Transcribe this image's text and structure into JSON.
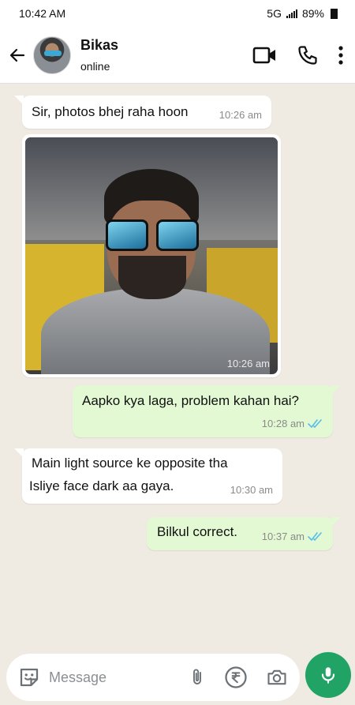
{
  "status_bar": {
    "time": "10:42 AM",
    "network": "5G",
    "battery": "89%"
  },
  "header": {
    "contact_name": "Bikas",
    "contact_status": "online",
    "icons": [
      "back-arrow-icon",
      "video-call-icon",
      "phone-icon",
      "more-options-icon"
    ]
  },
  "messages": [
    {
      "direction": "incoming",
      "text": "Sir, photos bhej raha hoon",
      "time": "10:26 am"
    },
    {
      "direction": "incoming",
      "type": "photo",
      "time": "10:26 am"
    },
    {
      "direction": "outgoing",
      "text": "Aapko kya laga, problem kahan hai?",
      "time": "10:28 am",
      "read": true
    },
    {
      "direction": "incoming",
      "text_line1": "Main light source ke opposite tha",
      "text_line2": "Isliye face dark aa gaya.",
      "time": "10:30 am"
    },
    {
      "direction": "outgoing",
      "text": "Bilkul correct.",
      "time": "10:37 am",
      "read": true
    }
  ],
  "input_bar": {
    "placeholder": "Message",
    "icons": [
      "sticker-icon",
      "attachment-icon",
      "rupee-payment-icon",
      "camera-icon",
      "mic-icon"
    ]
  },
  "colors": {
    "chat_background": "#efeae2",
    "outgoing_bubble": "#e2f9d3",
    "incoming_bubble": "#ffffff",
    "read_tick": "#53bdeb",
    "mic_button": "#21a366"
  }
}
